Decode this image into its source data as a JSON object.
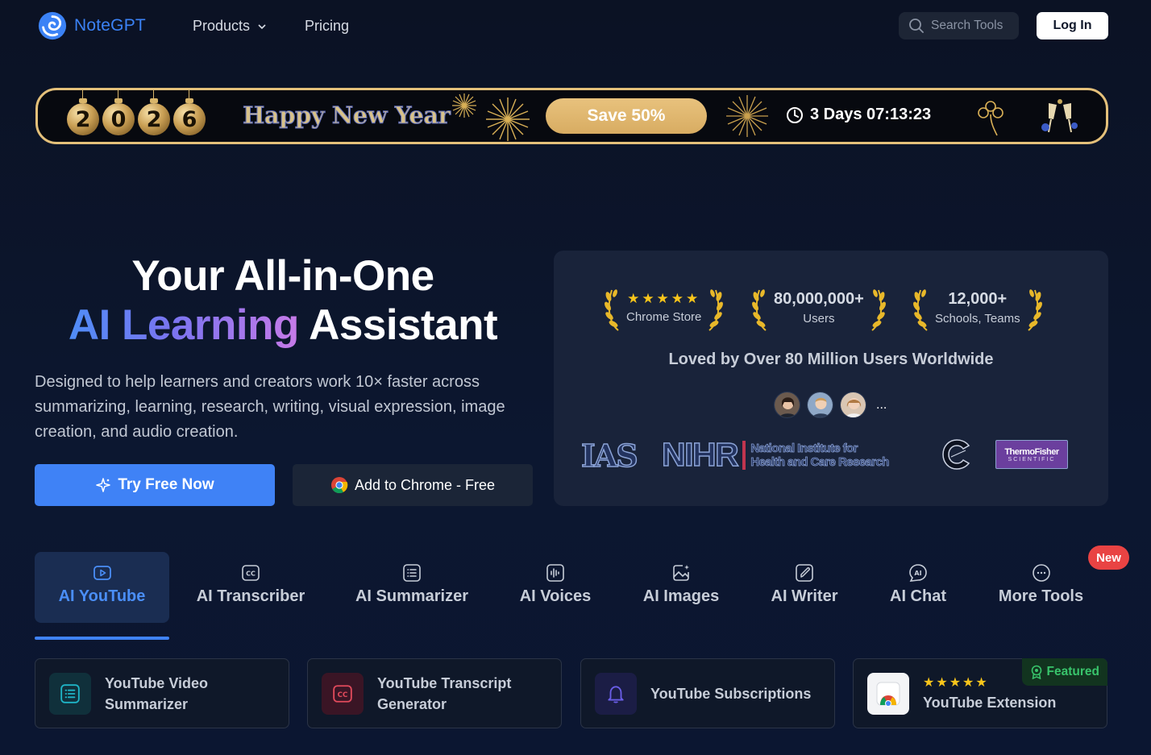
{
  "nav": {
    "brand": "NoteGPT",
    "products": "Products",
    "pricing": "Pricing",
    "search_placeholder": "Search Tools",
    "login": "Log In"
  },
  "promo": {
    "year_digits": [
      "2",
      "0",
      "2",
      "6"
    ],
    "greeting": "Happy New Year",
    "save": "Save 50%",
    "countdown": "3 Days 07:13:23"
  },
  "hero": {
    "title_line1": "Your All-in-One",
    "title_highlight": "AI Learning",
    "title_rest": " Assistant",
    "description": "Designed to help learners and creators work 10× faster across summarizing, learning, research, writing, visual expression, image creation, and audio creation.",
    "try_button": "Try Free Now",
    "chrome_button": "Add to Chrome - Free"
  },
  "stats": {
    "chrome_rating_stars": "★★★★★",
    "chrome_label": "Chrome Store",
    "users_value": "80,000,000+",
    "users_label": "Users",
    "schools_value": "12,000+",
    "schools_label": "Schools, Teams",
    "loved": "Loved by Over 80 Million Users Worldwide",
    "more": "...",
    "logos": {
      "ias": "IAS",
      "nihr": "NIHR",
      "nihr_line1": "National Institute for",
      "nihr_line2": "Health and Care Research",
      "tf_line1": "ThermoFisher",
      "tf_line2": "SCIENTIFIC"
    }
  },
  "tabs": [
    {
      "label": "AI YouTube",
      "icon": "youtube-play-icon",
      "active": true
    },
    {
      "label": "AI Transcriber",
      "icon": "closed-caption-icon"
    },
    {
      "label": "AI Summarizer",
      "icon": "list-icon"
    },
    {
      "label": "AI Voices",
      "icon": "waveform-icon"
    },
    {
      "label": "AI Images",
      "icon": "image-sparkle-icon"
    },
    {
      "label": "AI Writer",
      "icon": "pen-icon"
    },
    {
      "label": "AI Chat",
      "icon": "ai-chat-icon"
    },
    {
      "label": "More Tools",
      "icon": "more-icon"
    }
  ],
  "new_badge": "New",
  "cards": [
    {
      "line1": "YouTube Video",
      "line2": "Summarizer",
      "icon": "list-icon",
      "color": "#1fb5c7"
    },
    {
      "line1": "YouTube Transcript",
      "line2": "Generator",
      "icon": "closed-caption-icon",
      "color": "#e34b5c"
    },
    {
      "line1": "YouTube Subscriptions",
      "icon": "bell-icon",
      "color": "#6a5ee8"
    },
    {
      "line1": "YouTube Extension",
      "stars": "★★★★★",
      "featured": "Featured",
      "icon": "chrome-icon"
    }
  ],
  "colors": {
    "accent": "#3f82f6",
    "banner_gold": "#e4c07a",
    "new_red": "#e94343",
    "featured_green": "#38c46b",
    "star_yellow": "#f8c51b"
  }
}
